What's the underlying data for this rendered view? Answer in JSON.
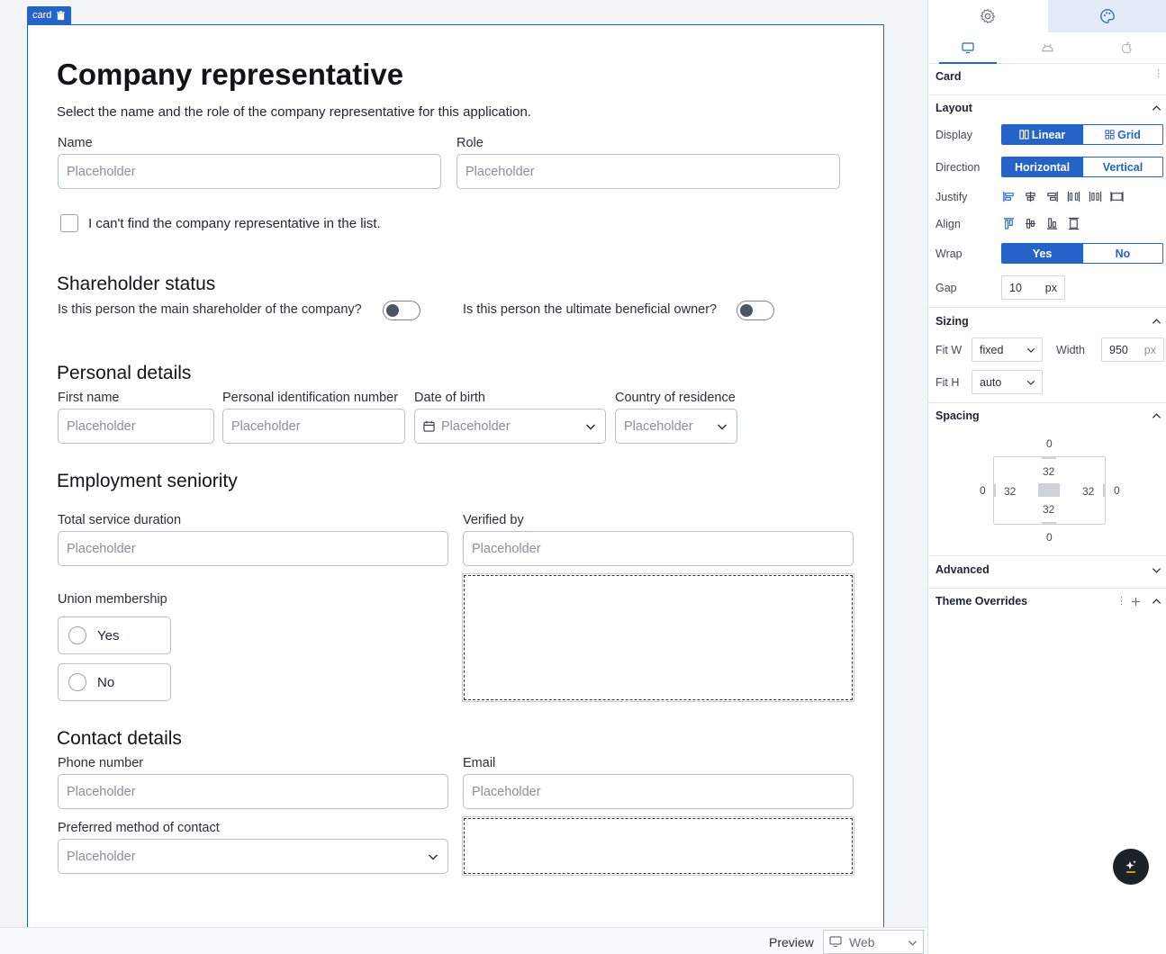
{
  "canvas": {
    "card_tag": "card",
    "title": "Company representative",
    "subtitle": "Select the name and the role of the company representative for this application.",
    "name_label": "Name",
    "role_label": "Role",
    "placeholder": "Placeholder",
    "checkbox_label": "I can't find the company representative in the list.",
    "shareholder": {
      "heading": "Shareholder status",
      "q1": "Is this person the main shareholder of the company?",
      "q2": "Is this person the ultimate beneficial owner?"
    },
    "personal": {
      "heading": "Personal details",
      "first_name": "First name",
      "pin": "Personal identification number",
      "dob": "Date of birth",
      "country": "Country of residence"
    },
    "employment": {
      "heading": "Employment seniority",
      "total": "Total service duration",
      "verified": "Verified by",
      "union": "Union membership",
      "yes": "Yes",
      "no": "No"
    },
    "contact": {
      "heading": "Contact details",
      "phone": "Phone number",
      "email": "Email",
      "preferred": "Preferred method of contact"
    }
  },
  "bottombar": {
    "preview_label": "Preview",
    "device": "Web"
  },
  "panel": {
    "component": "Card",
    "layout": {
      "heading": "Layout",
      "display_label": "Display",
      "display_linear": "Linear",
      "display_grid": "Grid",
      "display_selected": "Linear",
      "direction_label": "Direction",
      "horizontal": "Horizontal",
      "vertical": "Vertical",
      "direction_selected": "Horizontal",
      "justify_label": "Justify",
      "align_label": "Align",
      "wrap_label": "Wrap",
      "wrap_yes": "Yes",
      "wrap_no": "No",
      "wrap_selected": "Yes",
      "gap_label": "Gap",
      "gap_value": "10",
      "gap_unit": "px"
    },
    "sizing": {
      "heading": "Sizing",
      "fitw_label": "Fit W",
      "fitw_value": "fixed",
      "width_label": "Width",
      "width_value": "950",
      "width_unit": "px",
      "fith_label": "Fit H",
      "fith_value": "auto"
    },
    "spacing": {
      "heading": "Spacing",
      "margin_top": "0",
      "margin_bottom": "0",
      "margin_left": "0",
      "margin_right": "0",
      "padding_top": "32",
      "padding_bottom": "32",
      "padding_left": "32",
      "padding_right": "32"
    },
    "advanced": "Advanced",
    "theme_overrides": "Theme Overrides"
  },
  "colors": {
    "accent": "#2563c9",
    "tab_active_bg": "#e4ebf6",
    "ai_button": "#1d2128"
  }
}
